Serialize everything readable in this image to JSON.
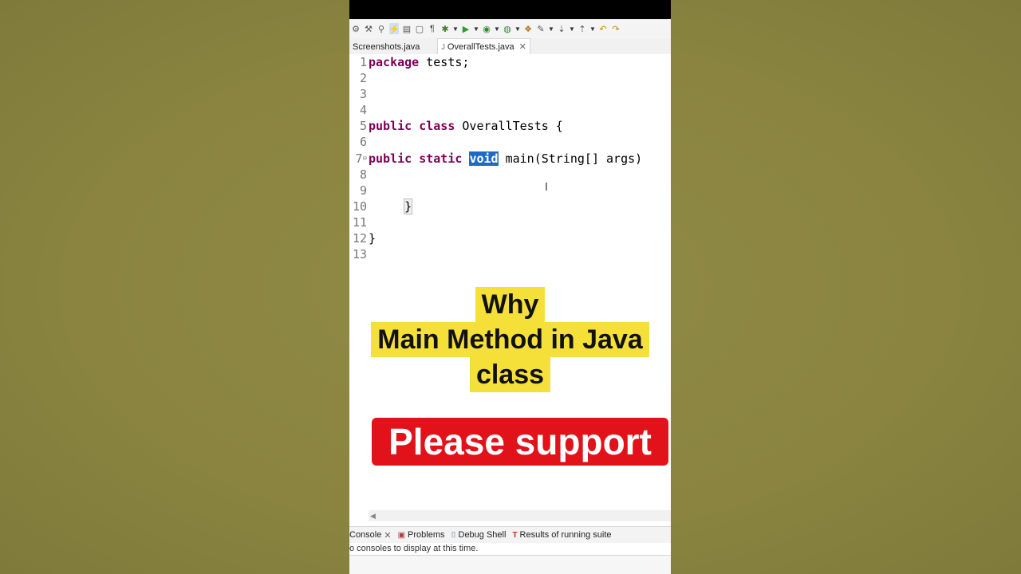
{
  "toolbar": {
    "icons": [
      "format-icon",
      "tools-icon",
      "wrench-icon",
      "pin-icon",
      "lightning-icon",
      "book-icon",
      "page-icon",
      "pilcrow-icon",
      "debug-icon",
      "run-icon",
      "coverage-icon",
      "external-tools-icon",
      "open-type-icon",
      "search-icon",
      "annotation-icon",
      "back-icon",
      "forward-icon"
    ]
  },
  "tabs": [
    {
      "label": "Screenshots.java",
      "active": false
    },
    {
      "label": "OverallTests.java",
      "active": true,
      "close": "✕"
    }
  ],
  "editor": {
    "line_numbers": [
      "1",
      "2",
      "3",
      "4",
      "5",
      "6",
      "7",
      "8",
      "9",
      "10",
      "11",
      "12",
      "13"
    ],
    "lines": {
      "l1_kw": "package",
      "l1_rest": " tests;",
      "l5_kw1": "public",
      "l5_kw2": "class",
      "l5_rest": " OverallTests {",
      "l7_kw1": "public",
      "l7_kw2": "static",
      "l7_sel": "void",
      "l7_rest": " main(String[] args)",
      "l10": "}",
      "l12": "}"
    }
  },
  "overlay": {
    "line1": "Why",
    "line2": "Main Method in Java",
    "line3": "class",
    "support": "Please support"
  },
  "panel": {
    "tabs": [
      {
        "label": "Console",
        "icon": "console-icon",
        "close": "✕"
      },
      {
        "label": "Problems",
        "icon": "problems-icon"
      },
      {
        "label": "Debug Shell",
        "icon": "debug-shell-icon"
      },
      {
        "label": "Results of running suite",
        "icon": "testng-icon"
      }
    ],
    "message": "o consoles to display at this time."
  },
  "colors": {
    "keyword": "#7f0055",
    "selection": "#1e6bc4",
    "highlight_yellow": "#f5e03a",
    "support_red": "#e1121a"
  }
}
